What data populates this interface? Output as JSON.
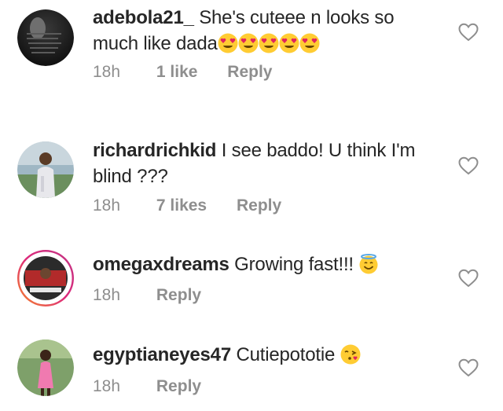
{
  "comments": [
    {
      "username": "adebola21_",
      "text": " She's cuteee n looks so much like dada",
      "emojis": [
        "heart-eyes-emoji",
        "heart-eyes-emoji",
        "heart-eyes-emoji",
        "heart-eyes-emoji",
        "heart-eyes-emoji"
      ],
      "time": "18h",
      "likes": "1 like",
      "reply": "Reply"
    },
    {
      "username": "richardrichkid",
      "text": " I see baddo! U think I'm blind ???",
      "time": "18h",
      "likes": "7 likes",
      "reply": "Reply"
    },
    {
      "username": "omegaxdreams",
      "text": " Growing fast!!! ",
      "emojis": [
        "smiling-face-with-halo-emoji"
      ],
      "time": "18h",
      "reply": "Reply"
    },
    {
      "username": "egyptianeyes47",
      "text": " Cutiepototie ",
      "emojis": [
        "face-blowing-kiss-emoji"
      ],
      "time": "18h",
      "reply": "Reply"
    }
  ],
  "colors": {
    "text": "#262626",
    "secondary": "#8e8e8e",
    "heart_outline": "#8e8e8e",
    "story_ring_start": "#f58529",
    "story_ring_end": "#dd2a7b",
    "emoji_yellow": "#ffcc33"
  },
  "icons": {
    "like": "heart-outline-icon"
  }
}
